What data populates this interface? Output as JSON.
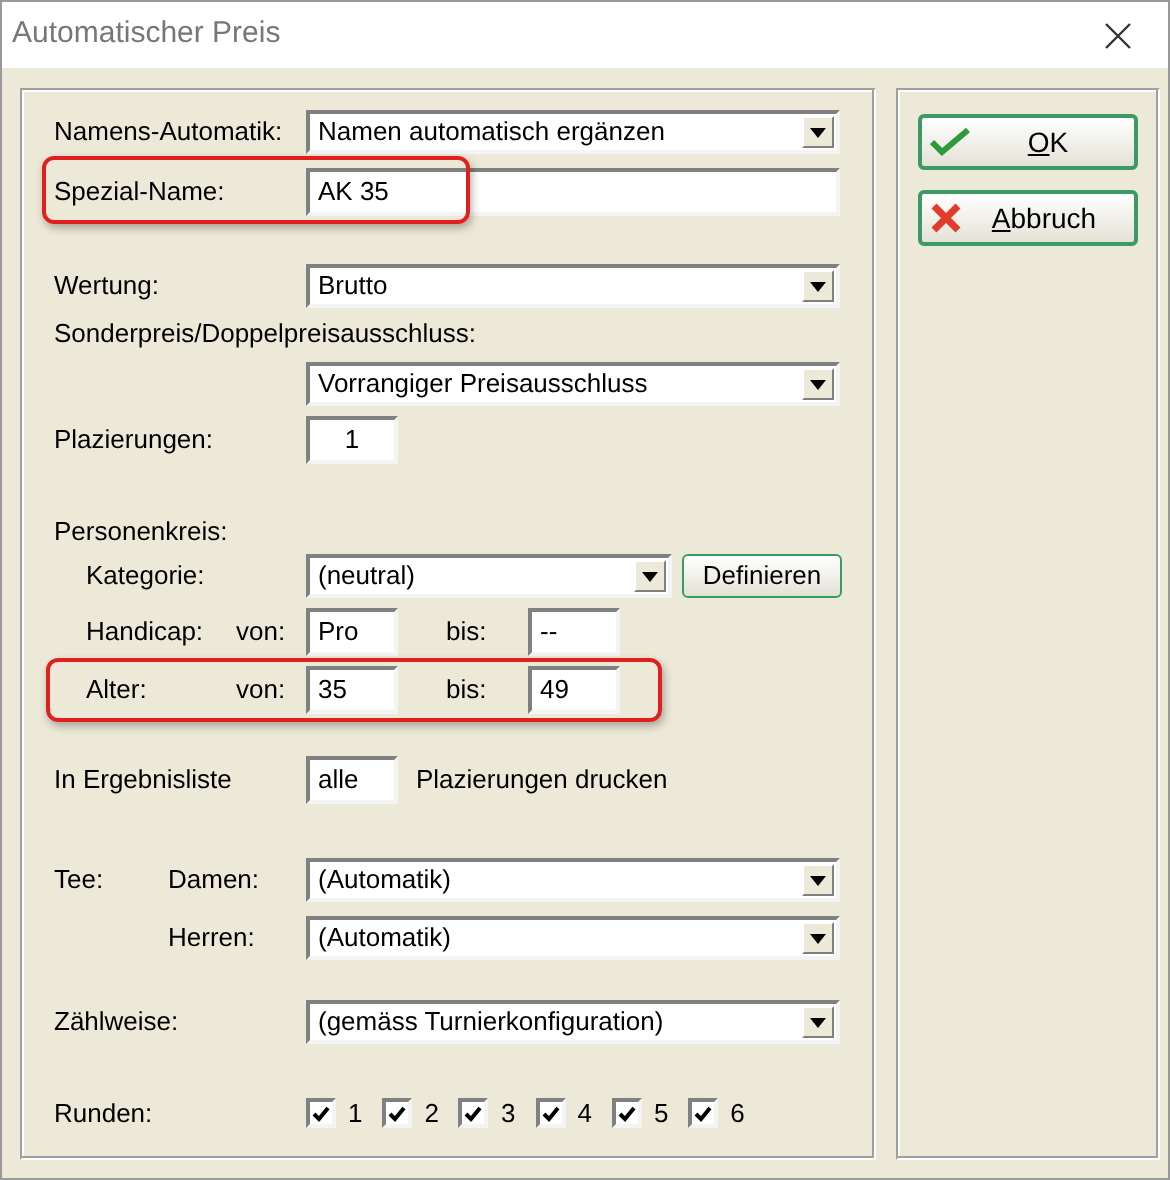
{
  "window": {
    "title": "Automatischer Preis"
  },
  "form": {
    "namens_automatik": {
      "label": "Namens-Automatik:",
      "value": "Namen automatisch ergänzen"
    },
    "spezial_name": {
      "label": "Spezial-Name:",
      "value": "AK 35",
      "highlighted": true
    },
    "wertung": {
      "label": "Wertung:",
      "value": "Brutto"
    },
    "sonderpreis": {
      "label": "Sonderpreis/Doppelpreisausschluss:",
      "value": "Vorrangiger Preisausschluss"
    },
    "plazierungen": {
      "label": "Plazierungen:",
      "value": "1"
    },
    "personenkreis": {
      "label": "Personenkreis:",
      "kategorie": {
        "label": "Kategorie:",
        "value": "(neutral)",
        "button": "Definieren"
      },
      "ranges": [
        {
          "label": "Handicap:",
          "from_label": "von:",
          "from": "Pro",
          "to_label": "bis:",
          "to": "--",
          "highlighted": false
        },
        {
          "label": "Alter:",
          "from_label": "von:",
          "from": "35",
          "to_label": "bis:",
          "to": "49",
          "highlighted": true
        }
      ]
    },
    "ergebnisliste": {
      "label": "In Ergebnisliste",
      "value": "alle",
      "suffix": "Plazierungen drucken"
    },
    "tee": {
      "label": "Tee:",
      "rows": [
        {
          "label": "Damen:",
          "value": "(Automatik)"
        },
        {
          "label": "Herren:",
          "value": "(Automatik)"
        }
      ]
    },
    "zaehlweise": {
      "label": "Zählweise:",
      "value": "(gemäss Turnierkonfiguration)"
    },
    "runden": {
      "label": "Runden:",
      "rounds": [
        {
          "label": "1",
          "checked": true
        },
        {
          "label": "2",
          "checked": true
        },
        {
          "label": "3",
          "checked": true
        },
        {
          "label": "4",
          "checked": true
        },
        {
          "label": "5",
          "checked": true
        },
        {
          "label": "6",
          "checked": true
        }
      ]
    }
  },
  "buttons": [
    {
      "label": "OK",
      "kind": "ok"
    },
    {
      "label": "Abbruch",
      "kind": "cancel"
    }
  ]
}
